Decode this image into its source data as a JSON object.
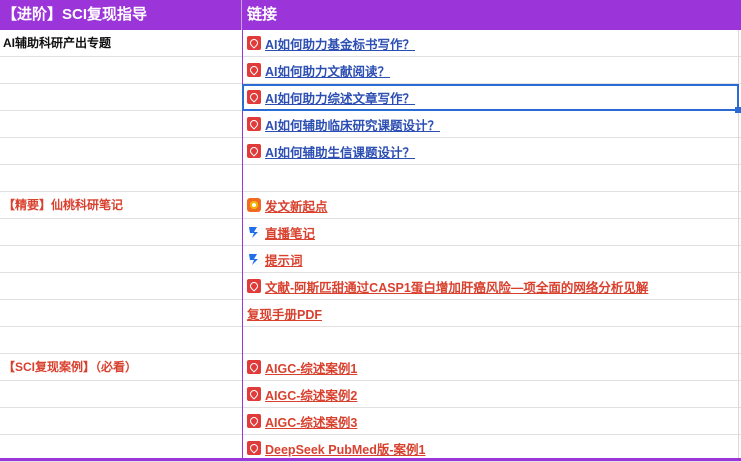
{
  "header": {
    "col1": "【进阶】SCI复现指导",
    "col2": "链接"
  },
  "sections": {
    "ai_projects": "AI辅助科研产出专题",
    "notes": "【精要】仙桃科研笔记",
    "cases": "【SCI复现案例】（必看）"
  },
  "links": [
    {
      "text": "AI如何助力基金标书写作？",
      "icon": "pdf-icon",
      "color": "blue"
    },
    {
      "text": "AI如何助力文献阅读？",
      "icon": "pdf-icon",
      "color": "blue"
    },
    {
      "text": "AI如何助力综述文章写作？",
      "icon": "pdf-icon",
      "color": "blue"
    },
    {
      "text": "AI如何辅助临床研究课题设计？",
      "icon": "pdf-icon",
      "color": "blue"
    },
    {
      "text": "AI如何辅助生信课题设计？",
      "icon": "pdf-icon",
      "color": "blue"
    },
    {
      "text": "发文新起点",
      "icon": "calendar-icon",
      "color": "red"
    },
    {
      "text": "直播笔记",
      "icon": "doc-icon",
      "color": "red"
    },
    {
      "text": "提示词",
      "icon": "doc-icon",
      "color": "red"
    },
    {
      "text": "文献-阿斯匹甜通过CASP1蛋白增加肝癌风险—项全面的网络分析见解",
      "icon": "pdf-icon",
      "color": "red"
    },
    {
      "text": "复现手册PDF",
      "icon": "none",
      "color": "red"
    },
    {
      "text": "AIGC-综述案例1",
      "icon": "pdf-icon",
      "color": "red"
    },
    {
      "text": "AIGC-综述案例2",
      "icon": "pdf-icon",
      "color": "red"
    },
    {
      "text": "AIGC-综述案例3",
      "icon": "pdf-icon",
      "color": "red"
    },
    {
      "text": "DeepSeek PubMed版-案例1",
      "icon": "pdf-icon",
      "color": "red"
    }
  ],
  "colors": {
    "header_bg": "#9b34d9",
    "link_blue": "#2d4fb3",
    "link_red": "#d9412f",
    "selection": "#2a6bd6"
  }
}
